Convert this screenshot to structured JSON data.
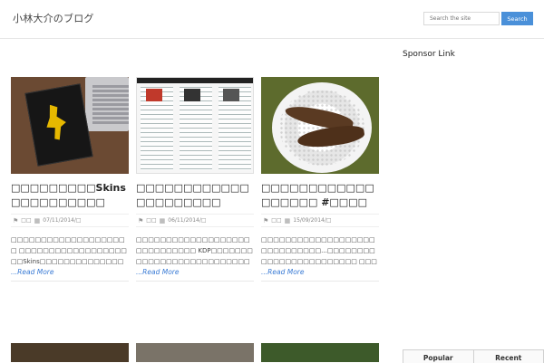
{
  "header": {
    "site_title": "小林大介のブログ",
    "search_placeholder": "Search the site",
    "search_button": "Search"
  },
  "sidebar": {
    "title": "Sponsor Link",
    "tabs": [
      "Popular",
      "Recent"
    ]
  },
  "posts": [
    {
      "title": "□□□□□□□□□Skins□□□□□□□□□□",
      "category": "□□",
      "date": "07/11/2014/□",
      "excerpt": "□□□□□□□□□□□□□□□□□□□□ □□□□□□□□□□□□□□□□□□□□Skins□□□□□□□□□□□□□□□□□□□□□□□□□□□□□□□□□□□□□□□□□□□□□□□□□□□□□□ [...]",
      "read_more": "...Read More"
    },
    {
      "title": "□□□□□□□□□□□□□□□□□□□□□",
      "category": "□□",
      "date": "06/11/2014/□",
      "excerpt": "□□□□□□□□□□□□□□□□□□□□□□□□□□□□□ KDP□□□□□□□□□□□□□□□□□□□□□□□□□□□□□□□□□□□□□□□□□□□□□□□□□□□□□□□□□ [...]",
      "read_more": "...Read More"
    },
    {
      "title": "□□□□□□□□□□□□□□□□□□ #□□□□",
      "category": "□□",
      "date": "15/09/2014/□",
      "excerpt": "□□□□□□□□□□□□□□□□□□□□□□□□□□□□□...□□□□□□□□□□□□□□□□□□□□□□□□ □□□□□□□□□ □□□□□□□□□□□□□□□□ □□□□□□□□□□□□□□□□□□□ [...]",
      "read_more": "...Read More"
    }
  ]
}
